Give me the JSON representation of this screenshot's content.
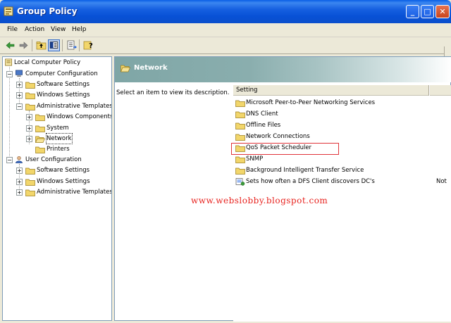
{
  "window": {
    "title": "Group Policy",
    "icon": "group-policy-icon",
    "controls": [
      "minimize-icon",
      "maximize-icon",
      "close-icon"
    ]
  },
  "menu": {
    "file": "File",
    "action": "Action",
    "view": "View",
    "help": "Help"
  },
  "toolbar": {
    "icons": [
      "back-arrow-icon",
      "forward-arrow-icon",
      "up-folder-icon",
      "show-hide-tree-icon",
      "export-list-icon",
      "help-icon"
    ]
  },
  "tree": {
    "root": "Local Computer Policy",
    "computer_config": "Computer Configuration",
    "cc_software": "Software Settings",
    "cc_windows": "Windows Settings",
    "cc_admin": "Administrative Templates",
    "cc_admin_wincomp": "Windows Components",
    "cc_admin_system": "System",
    "cc_admin_network": "Network",
    "cc_admin_printers": "Printers",
    "user_config": "User Configuration",
    "uc_software": "Software Settings",
    "uc_windows": "Windows Settings",
    "uc_admin": "Administrative Templates"
  },
  "right": {
    "header_title": "Network",
    "description": "Select an item to view its description.",
    "column_setting": "Setting",
    "items": [
      {
        "label": "Microsoft Peer-to-Peer Networking Services",
        "icon": "folder-icon"
      },
      {
        "label": "DNS Client",
        "icon": "folder-icon"
      },
      {
        "label": "Offline Files",
        "icon": "folder-icon"
      },
      {
        "label": "Network Connections",
        "icon": "folder-icon"
      },
      {
        "label": "QoS Packet Scheduler",
        "icon": "folder-icon"
      },
      {
        "label": "SNMP",
        "icon": "folder-icon"
      },
      {
        "label": "Background Intelligent Transfer Service",
        "icon": "folder-icon"
      },
      {
        "label": "Sets how often a DFS Client discovers DC's",
        "icon": "policy-setting-icon",
        "state": "Not"
      }
    ]
  },
  "watermark": "www.webslobby.blogspot.com",
  "colors": {
    "titlebar": "#0a5fe6",
    "header_gradient_start": "#7fa6a6",
    "highlight_box": "#e0343a",
    "watermark": "#e8231f",
    "folder": "#f2d66b"
  }
}
